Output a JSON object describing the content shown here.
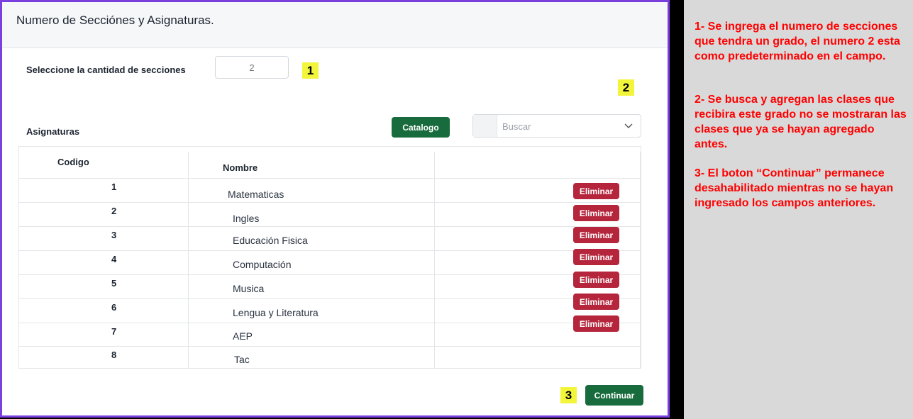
{
  "dialog": {
    "title": "Numero de Secciónes y Asignaturas.",
    "sections_label": "Seleccione la cantidad de secciones",
    "sections_placeholder": "2",
    "subjects_label": "Asignaturas",
    "catalog_button": "Catalogo",
    "search_placeholder": "Buscar",
    "continue_button": "Continuar"
  },
  "markers": [
    "1",
    "2",
    "3"
  ],
  "table": {
    "headers": {
      "code": "Codigo",
      "name": "Nombre"
    },
    "delete_label": "Eliminar",
    "rows": [
      {
        "code": "1",
        "name": "Matematicas"
      },
      {
        "code": "2",
        "name": "Ingles"
      },
      {
        "code": "3",
        "name": "Educación Fisica"
      },
      {
        "code": "4",
        "name": "Computación"
      },
      {
        "code": "5",
        "name": "Musica"
      },
      {
        "code": "6",
        "name": "Lengua y Literatura"
      },
      {
        "code": "7",
        "name": "AEP"
      },
      {
        "code": "8",
        "name": "Tac"
      }
    ]
  },
  "notes": [
    "1- Se ingrega el numero de secciones que tendra un grado, el numero 2 esta como predeterminado en el campo.",
    "2- Se busca y agregan las clases que recibira este grado no se mostraran las clases que ya se hayan agregado antes.",
    "3- El boton “Continuar” permanece desahabilitado mientras no se hayan ingresado los campos anteriores."
  ],
  "colors": {
    "accent_border": "#7b3fe0",
    "primary_button": "#176b3c",
    "danger_button": "#b5263c",
    "marker": "#f2f53a",
    "note_text": "#ff0000"
  }
}
